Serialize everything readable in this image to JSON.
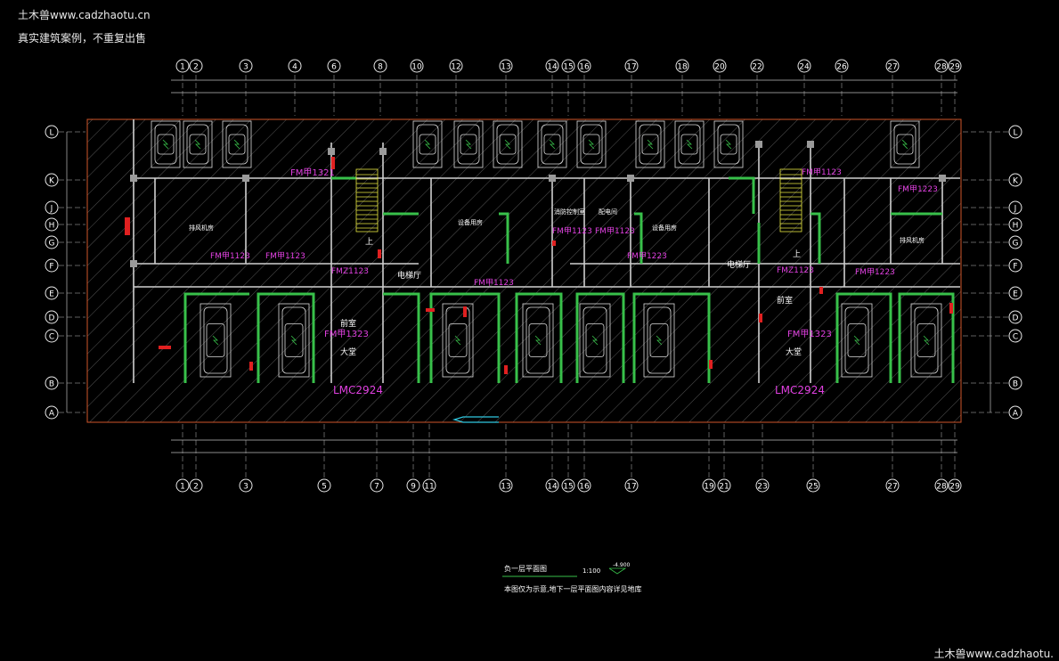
{
  "watermark": {
    "line1": "土木兽www.cadzhaotu.cn",
    "line2": "真实建筑案例，不重复出售",
    "bottom_right": "土木兽www.cadzhaotu."
  },
  "axes": {
    "top": [
      "1",
      "2",
      "3",
      "4",
      "6",
      "8",
      "10",
      "12",
      "13",
      "14",
      "15",
      "16",
      "17",
      "18",
      "20",
      "22",
      "24",
      "26",
      "27",
      "28",
      "29"
    ],
    "bottom": [
      "1",
      "2",
      "3",
      "5",
      "7",
      "9",
      "11",
      "13",
      "14",
      "15",
      "16",
      "17",
      "19",
      "21",
      "23",
      "25",
      "27",
      "28",
      "29"
    ],
    "rows": [
      "L",
      "K",
      "J",
      "H",
      "G",
      "F",
      "E",
      "D",
      "C",
      "B",
      "A"
    ]
  },
  "labels": {
    "door_large": "LMC2924",
    "door_fm1321": "FM甲1321",
    "door_fm1123": "FM甲1123",
    "door_fm1223": "FM甲1223",
    "door_fmz1123": "FMZ1123",
    "door_fmz1123r": "FMZ1123",
    "door_fm1323": "FM甲1323",
    "door_fm1321_v": "FM甲1321",
    "elevator_hall": "电梯厅",
    "front_room": "前室",
    "lobby": "大堂",
    "up": "上",
    "fan_room": "排风机房",
    "pump_room": "设备用房",
    "fire_room": "消防控制室",
    "side_room": "配电间"
  },
  "title": {
    "name": "负一层平面图",
    "scale": "1:100",
    "level": "-4.900",
    "note": "本图仅为示意,地下一层平面图内容详见地库"
  }
}
